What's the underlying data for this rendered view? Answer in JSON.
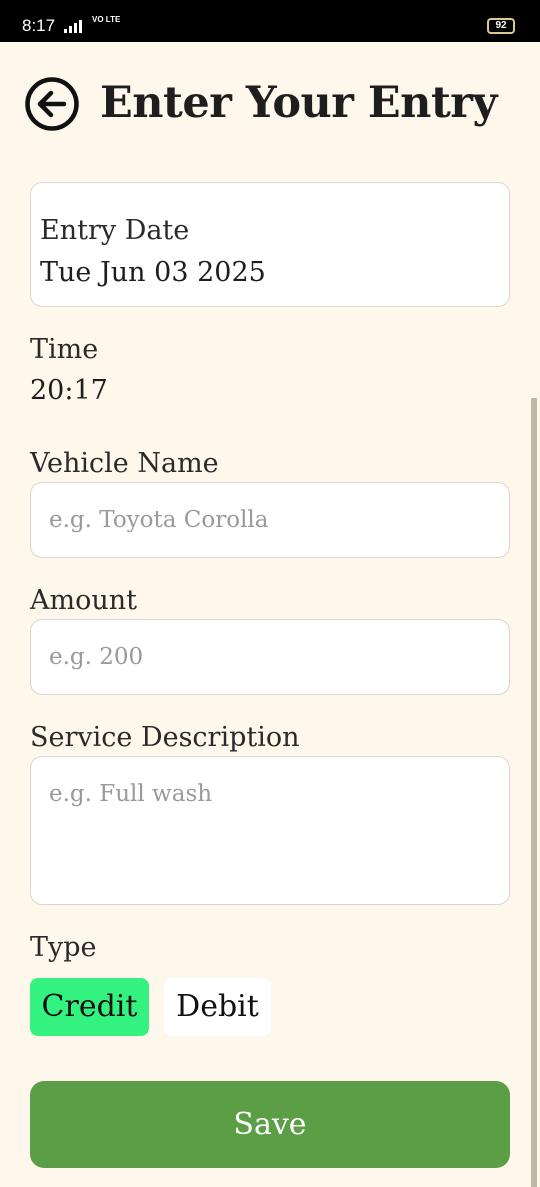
{
  "status_bar": {
    "time": "8:17",
    "network": "VO LTE",
    "battery": "92"
  },
  "header": {
    "title": "Enter Your Entry"
  },
  "entry_date": {
    "label": "Entry Date",
    "value": "Tue Jun 03 2025"
  },
  "time": {
    "label": "Time",
    "value": "20:17"
  },
  "vehicle_name": {
    "label": "Vehicle Name",
    "placeholder": "e.g. Toyota Corolla",
    "value": ""
  },
  "amount": {
    "label": "Amount",
    "placeholder": "e.g. 200",
    "value": ""
  },
  "service_description": {
    "label": "Service Description",
    "placeholder": "e.g. Full wash",
    "value": ""
  },
  "type": {
    "label": "Type",
    "options": [
      "Credit",
      "Debit"
    ],
    "selected": "Credit"
  },
  "save_label": "Save",
  "colors": {
    "background": "#fdf7ec",
    "credit_selected": "#33f27f",
    "save_button": "#5b9e45"
  }
}
